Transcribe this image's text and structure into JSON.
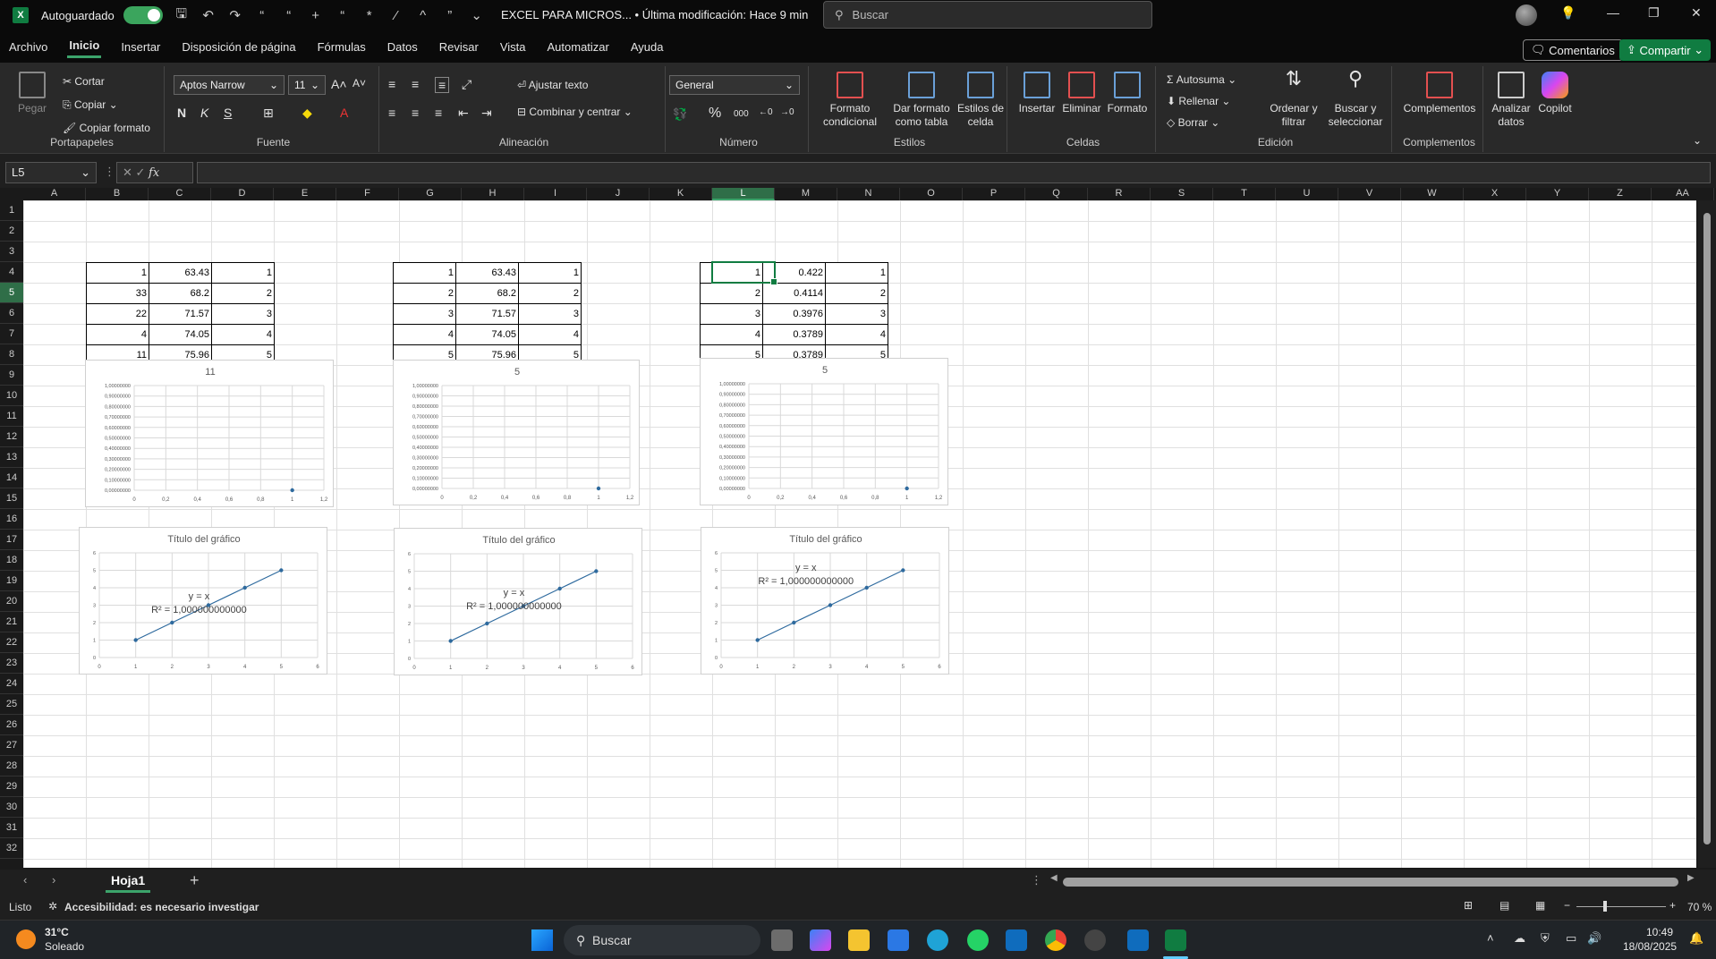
{
  "titlebar": {
    "autosave_label": "Autoguardado",
    "doc_title": "EXCEL PARA MICROS... • Última modificación: Hace 9 min",
    "search_placeholder": "Buscar"
  },
  "menu": {
    "items": [
      "Archivo",
      "Inicio",
      "Insertar",
      "Disposición de página",
      "Fórmulas",
      "Datos",
      "Revisar",
      "Vista",
      "Automatizar",
      "Ayuda"
    ],
    "active": "Inicio",
    "comments_label": "Comentarios",
    "share_label": "Compartir"
  },
  "ribbon": {
    "portapapeles": {
      "label": "Portapapeles",
      "paste": "Pegar",
      "cut": "Cortar",
      "copy": "Copiar",
      "format_painter": "Copiar formato"
    },
    "fuente": {
      "label": "Fuente",
      "font_name": "Aptos Narrow",
      "font_size": "11"
    },
    "alineacion": {
      "label": "Alineación",
      "wrap": "Ajustar texto",
      "merge": "Combinar y centrar"
    },
    "numero": {
      "label": "Número",
      "format": "General"
    },
    "estilos": {
      "label": "Estilos",
      "cond_format": "Formato condicional",
      "as_table": "Dar formato como tabla",
      "cell_styles": "Estilos de celda"
    },
    "celdas": {
      "label": "Celdas",
      "insert": "Insertar",
      "delete": "Eliminar",
      "format": "Formato"
    },
    "edicion": {
      "label": "Edición",
      "autosum": "Autosuma",
      "fill": "Rellenar",
      "clear": "Borrar",
      "sort": "Ordenar y filtrar",
      "find": "Buscar y seleccionar"
    },
    "complementos": {
      "label": "Complementos",
      "btn": "Complementos"
    },
    "analyze": "Analizar datos",
    "copilot": "Copilot"
  },
  "formula_bar": {
    "name_box": "L5",
    "fx": "fx"
  },
  "columns": [
    "A",
    "B",
    "C",
    "D",
    "E",
    "F",
    "G",
    "H",
    "I",
    "J",
    "K",
    "L",
    "M",
    "N",
    "O",
    "P",
    "Q",
    "R",
    "S",
    "T",
    "U",
    "V",
    "W",
    "X",
    "Y",
    "Z",
    "AA"
  ],
  "selected_column": "L",
  "rows": [
    "1",
    "2",
    "3",
    "4",
    "5",
    "6",
    "7",
    "8",
    "9",
    "10",
    "11",
    "12",
    "13",
    "14",
    "15",
    "16",
    "17",
    "18",
    "19",
    "20",
    "21",
    "22",
    "23",
    "24",
    "25",
    "26",
    "27",
    "28",
    "29",
    "30",
    "31",
    "32"
  ],
  "selected_row": "5",
  "tables": [
    {
      "rows": [
        [
          "1",
          "63.43",
          "1"
        ],
        [
          "33",
          "68.2",
          "2"
        ],
        [
          "22",
          "71.57",
          "3"
        ],
        [
          "4",
          "74.05",
          "4"
        ],
        [
          "11",
          "75.96",
          "5"
        ]
      ]
    },
    {
      "rows": [
        [
          "1",
          "63.43",
          "1"
        ],
        [
          "2",
          "68.2",
          "2"
        ],
        [
          "3",
          "71.57",
          "3"
        ],
        [
          "4",
          "74.05",
          "4"
        ],
        [
          "5",
          "75.96",
          "5"
        ]
      ]
    },
    {
      "rows": [
        [
          "1",
          "0.422",
          "1"
        ],
        [
          "2",
          "0.4114",
          "2"
        ],
        [
          "3",
          "0.3976",
          "3"
        ],
        [
          "4",
          "0.3789",
          "4"
        ],
        [
          "5",
          "0.3789",
          "5"
        ]
      ]
    }
  ],
  "chart_data": [
    {
      "type": "scatter",
      "title": "11",
      "x": [
        1
      ],
      "y": [
        0
      ],
      "xlim": [
        0,
        1.2
      ],
      "ylim": [
        0,
        1
      ],
      "xticks": [
        "0",
        "0,2",
        "0,4",
        "0,6",
        "0,8",
        "1",
        "1,2"
      ],
      "yticks": [
        "0,00000000",
        "0,10000000",
        "0,20000000",
        "0,30000000",
        "0,40000000",
        "0,50000000",
        "0,60000000",
        "0,70000000",
        "0,80000000",
        "0,90000000",
        "1,00000000"
      ],
      "grid": true
    },
    {
      "type": "scatter",
      "title": "5",
      "x": [
        1
      ],
      "y": [
        0
      ],
      "xlim": [
        0,
        1.2
      ],
      "ylim": [
        0,
        1
      ],
      "xticks": [
        "0",
        "0,2",
        "0,4",
        "0,6",
        "0,8",
        "1",
        "1,2"
      ],
      "yticks": [
        "0,00000000",
        "0,10000000",
        "0,20000000",
        "0,30000000",
        "0,40000000",
        "0,50000000",
        "0,60000000",
        "0,70000000",
        "0,80000000",
        "0,90000000",
        "1,00000000"
      ],
      "grid": true
    },
    {
      "type": "scatter",
      "title": "5",
      "x": [
        1
      ],
      "y": [
        0
      ],
      "xlim": [
        0,
        1.2
      ],
      "ylim": [
        0,
        1
      ],
      "xticks": [
        "0",
        "0,2",
        "0,4",
        "0,6",
        "0,8",
        "1",
        "1,2"
      ],
      "yticks": [
        "0,00000000",
        "0,10000000",
        "0,20000000",
        "0,30000000",
        "0,40000000",
        "0,50000000",
        "0,60000000",
        "0,70000000",
        "0,80000000",
        "0,90000000",
        "1,00000000"
      ],
      "grid": true
    },
    {
      "type": "line",
      "title": "Título del gráfico",
      "x": [
        1,
        2,
        3,
        4,
        5
      ],
      "y": [
        1,
        2,
        3,
        4,
        5
      ],
      "xlim": [
        0,
        6
      ],
      "ylim": [
        0,
        6
      ],
      "xticks": [
        "0",
        "1",
        "2",
        "3",
        "4",
        "5",
        "6"
      ],
      "yticks": [
        "0",
        "1",
        "2",
        "3",
        "4",
        "5",
        "6"
      ],
      "equation": "y = x",
      "r2": "R² = 1,000000000000",
      "grid": true
    },
    {
      "type": "line",
      "title": "Título del gráfico",
      "x": [
        1,
        2,
        3,
        4,
        5
      ],
      "y": [
        1,
        2,
        3,
        4,
        5
      ],
      "xlim": [
        0,
        6
      ],
      "ylim": [
        0,
        6
      ],
      "xticks": [
        "0",
        "1",
        "2",
        "3",
        "4",
        "5",
        "6"
      ],
      "yticks": [
        "0",
        "1",
        "2",
        "3",
        "4",
        "5",
        "6"
      ],
      "equation": "y = x",
      "r2": "R² = 1,000000000000",
      "grid": true
    },
    {
      "type": "line",
      "title": "Título del gráfico",
      "x": [
        1,
        2,
        3,
        4,
        5
      ],
      "y": [
        1,
        2,
        3,
        4,
        5
      ],
      "xlim": [
        0,
        6
      ],
      "ylim": [
        0,
        6
      ],
      "xticks": [
        "0",
        "1",
        "2",
        "3",
        "4",
        "5",
        "6"
      ],
      "yticks": [
        "0",
        "1",
        "2",
        "3",
        "4",
        "5",
        "6"
      ],
      "equation": "y = x",
      "r2": "R² = 1,000000000000",
      "grid": true
    }
  ],
  "sheet_tab": "Hoja1",
  "status": {
    "ready": "Listo",
    "accessibility": "Accesibilidad: es necesario investigar",
    "zoom": "70 %"
  },
  "taskbar": {
    "temp": "31°C",
    "weather": "Soleado",
    "search": "Buscar",
    "time": "10:49",
    "date": "18/08/2025"
  },
  "colors": {
    "accent": "#107c41",
    "series": "#2e6a9e"
  }
}
